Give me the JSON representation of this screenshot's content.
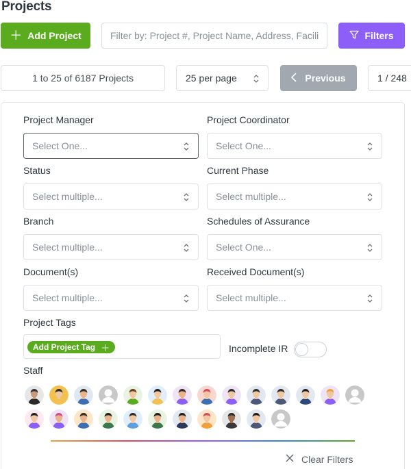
{
  "header": {
    "title": "Projects"
  },
  "toolbar": {
    "add_project_label": "Add Project",
    "search_placeholder": "Filter by: Project #, Project Name, Address, Facility",
    "filters_label": "Filters"
  },
  "pagination": {
    "summary": "1 to 25 of 6187 Projects",
    "per_page": "25 per page",
    "previous_label": "Previous",
    "page": "1 / 248"
  },
  "filters": {
    "project_manager": {
      "label": "Project Manager",
      "placeholder": "Select One..."
    },
    "project_coordinator": {
      "label": "Project Coordinator",
      "placeholder": "Select One..."
    },
    "status": {
      "label": "Status",
      "placeholder": "Select multiple..."
    },
    "current_phase": {
      "label": "Current Phase",
      "placeholder": "Select multiple..."
    },
    "branch": {
      "label": "Branch",
      "placeholder": "Select multiple..."
    },
    "schedules": {
      "label": "Schedules of Assurance",
      "placeholder": "Select One..."
    },
    "documents": {
      "label": "Document(s)",
      "placeholder": "Select multiple..."
    },
    "received_documents": {
      "label": "Received Document(s)",
      "placeholder": "Select multiple..."
    },
    "project_tags": {
      "label": "Project Tags",
      "add_tag_label": "Add Project Tag"
    },
    "incomplete_ir": {
      "label": "Incomplete IR",
      "enabled": false
    },
    "staff": {
      "label": "Staff"
    },
    "clear_label": "Clear Filters"
  },
  "colors": {
    "add_green": "#5aab1e",
    "filters_purple": "#8e5ef9",
    "previous_gray": "#a2a8b0"
  }
}
